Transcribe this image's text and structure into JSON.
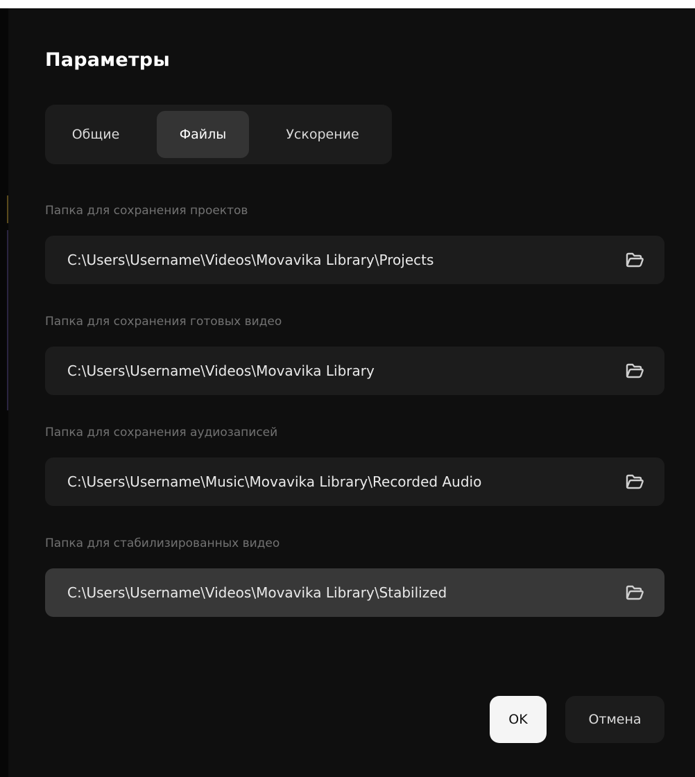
{
  "dialog": {
    "title": "Параметры"
  },
  "tabs": [
    {
      "label": "Общие",
      "selected": false
    },
    {
      "label": "Файлы",
      "selected": true
    },
    {
      "label": "Ускорение",
      "selected": false
    }
  ],
  "folders": [
    {
      "label": "Папка для сохранения проектов",
      "path": "C:\\Users\\Username\\Videos\\Movavika Library\\Projects",
      "icon": "folder-icon"
    },
    {
      "label": "Папка для сохранения готовых видео",
      "path": "C:\\Users\\Username\\Videos\\Movavika Library",
      "icon": "folder-icon"
    },
    {
      "label": "Папка для сохранения аудиозаписей",
      "path": "C:\\Users\\Username\\Music\\Movavika Library\\Recorded Audio",
      "icon": "folder-icon"
    },
    {
      "label": "Папка для стабилизированных видео",
      "path": "C:\\Users\\Username\\Videos\\Movavika Library\\Stabilized",
      "icon": "folder-icon",
      "hovered": true
    }
  ],
  "buttons": {
    "ok_label": "OK",
    "cancel_label": "Отмена"
  },
  "colors": {
    "background": "#0f0f0f",
    "panel": "#1c1c1c",
    "tab_selected": "#343434",
    "field_hover": "#383838",
    "label_text": "#727272",
    "ok_button": "#f5f5f5"
  }
}
